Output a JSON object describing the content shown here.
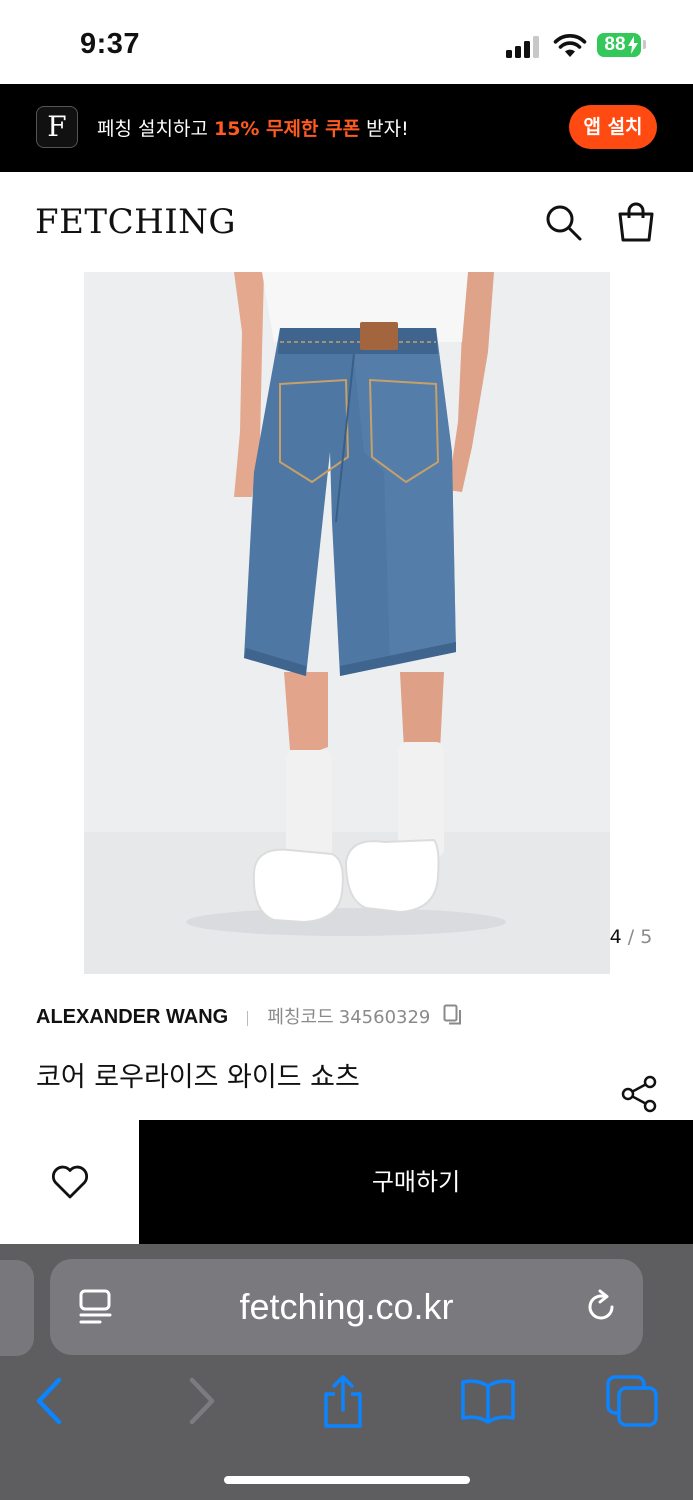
{
  "status_bar": {
    "time": "9:37",
    "battery_percent": "88",
    "signal_bars_active": 3,
    "icons": [
      "signal-icon",
      "wifi-icon",
      "battery-charging-icon"
    ]
  },
  "promo_banner": {
    "app_logo_letter": "F",
    "text_prefix": "페칭 설치하고 ",
    "text_highlight": "15% 무제한 쿠폰",
    "text_suffix": " 받자!",
    "install_button": "앱 설치",
    "highlight_color": "#ff5a1f"
  },
  "header": {
    "logo": "FETCHING",
    "icons": [
      "search-icon",
      "shopping-bag-icon"
    ]
  },
  "gallery": {
    "current": "4",
    "separator": "/",
    "total": "5"
  },
  "product": {
    "brand": "ALEXANDER WANG",
    "code_label": "페칭코드",
    "code": "34560329",
    "name": "코어 로우라이즈 와이드 쇼츠"
  },
  "actions": {
    "buy_label": "구매하기",
    "icons": [
      "heart-icon",
      "share-icon",
      "copy-icon"
    ]
  },
  "browser": {
    "url": "fetching.co.kr",
    "icons": [
      "reader-icon",
      "reload-icon",
      "back-icon",
      "forward-icon",
      "share-icon",
      "bookmarks-icon",
      "tabs-icon"
    ],
    "accent_color": "#0a84ff"
  }
}
